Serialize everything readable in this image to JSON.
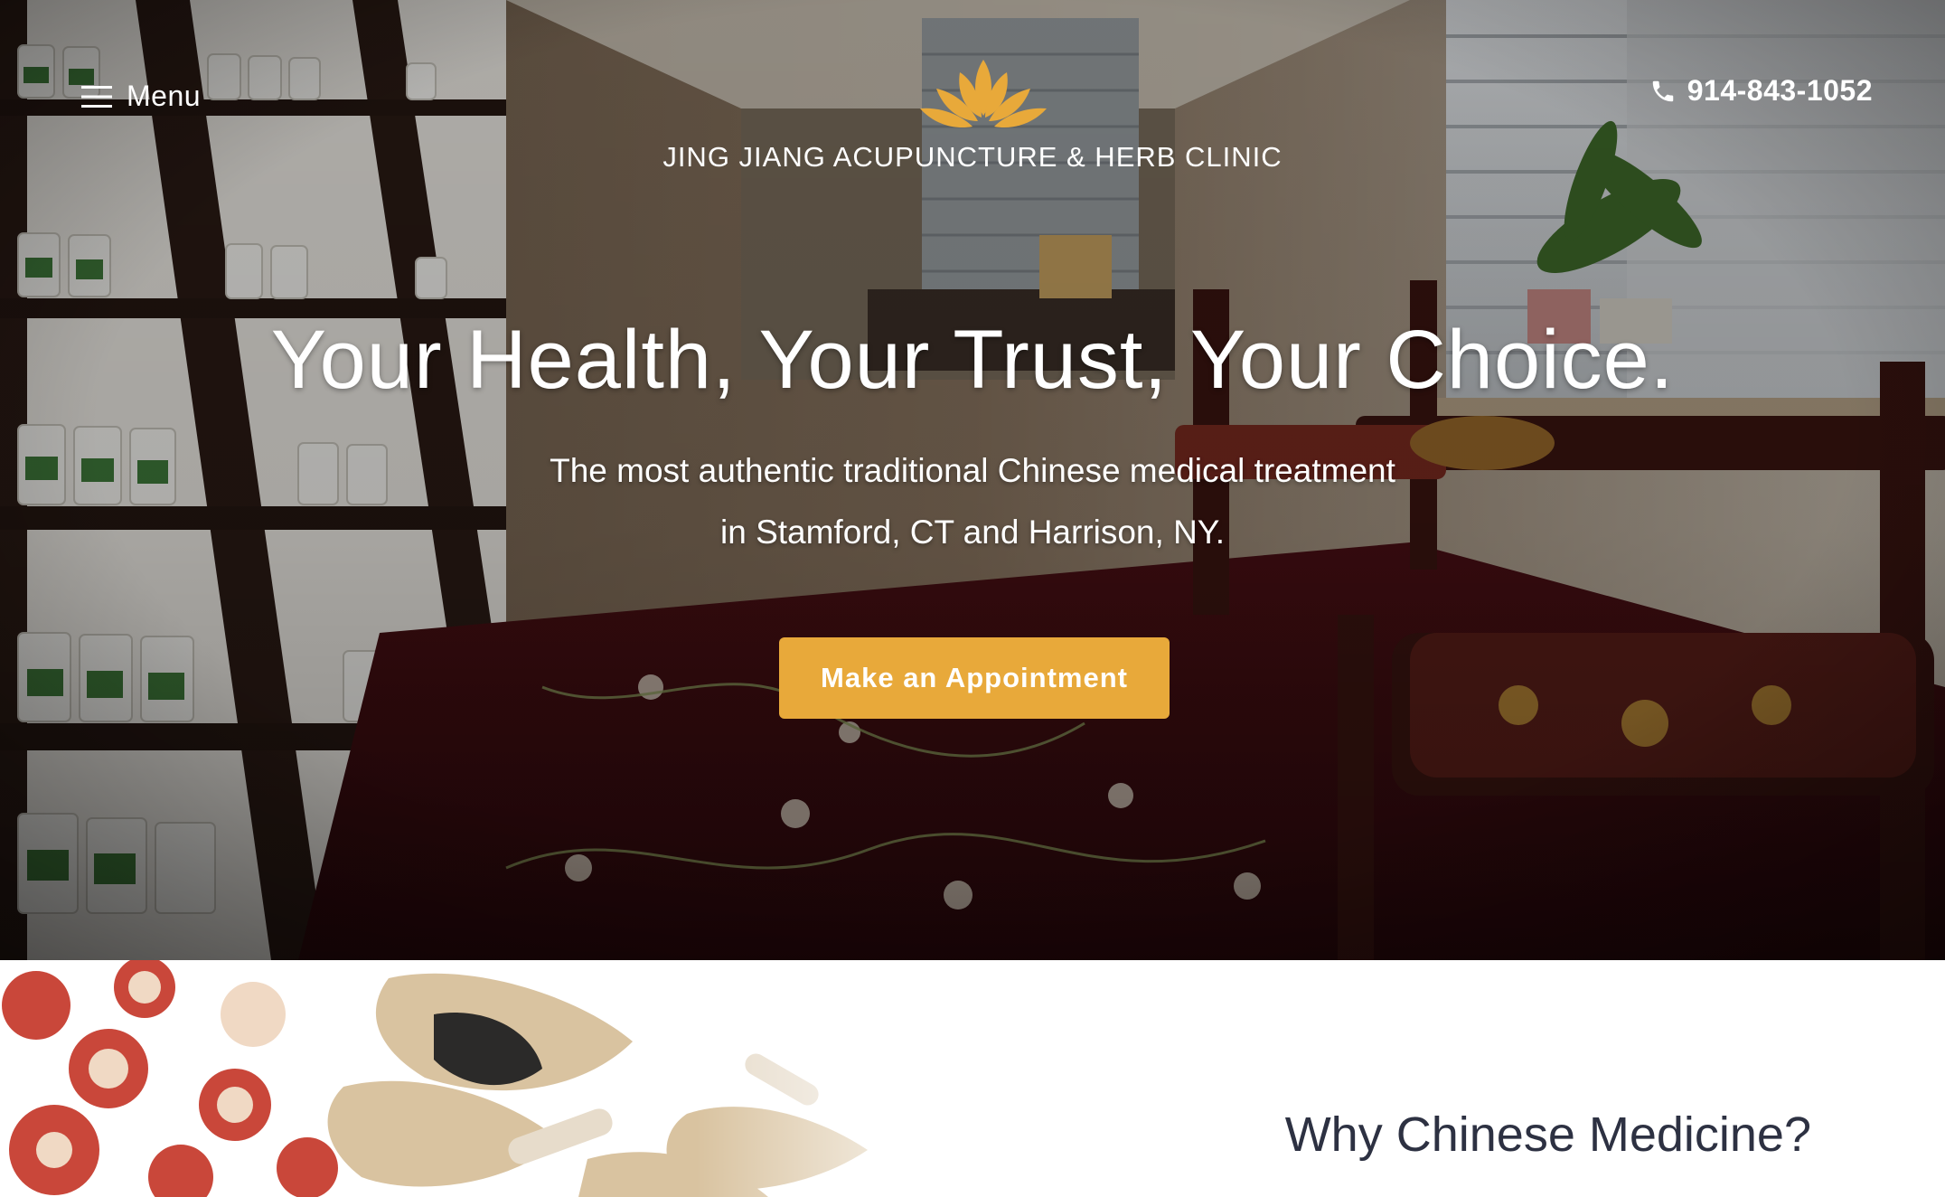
{
  "header": {
    "menu_label": "Menu",
    "phone_number": "914-843-1052",
    "clinic_name": "JING JIANG ACUPUNCTURE & HERB CLINIC",
    "logo_icon": "lotus-logo-icon",
    "brand_color": "#e8a93a"
  },
  "hero": {
    "headline": "Your Health, Your Trust, Your Choice.",
    "subline_1": "The most authentic traditional Chinese medical treatment",
    "subline_2": "in Stamford, CT and Harrison, NY.",
    "cta_label": "Make an Appointment"
  },
  "section": {
    "title": "Why Chinese Medicine?"
  }
}
